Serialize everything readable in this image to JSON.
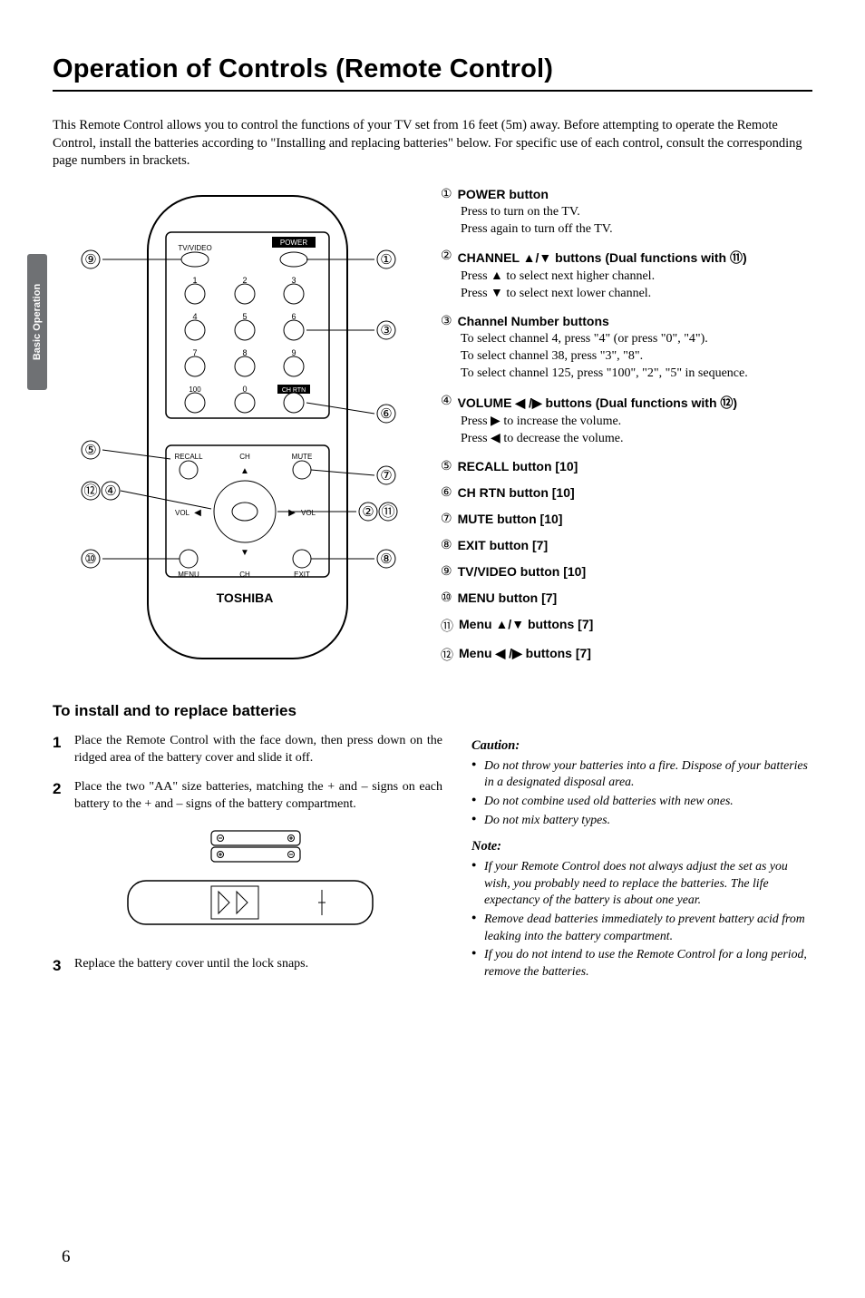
{
  "sidetab": "Basic Operation",
  "title": "Operation of Controls (Remote Control)",
  "intro": "This Remote Control allows you to control the functions of your TV set from 16 feet (5m) away. Before attempting to operate the Remote Control, install the batteries according to \"Installing and replacing batteries\" below. For specific use of each control, consult the corresponding page numbers in brackets.",
  "remote": {
    "labels": {
      "tvvideo": "TV/VIDEO",
      "power": "POWER",
      "recall": "RECALL",
      "ch_top": "CH",
      "mute": "MUTE",
      "vol_l": "VOL",
      "vol_r": "VOL",
      "menu": "MENU",
      "ch_bot": "CH",
      "exit": "EXIT",
      "chrtn": "CH RTN",
      "brand": "TOSHIBA",
      "k1": "1",
      "k2": "2",
      "k3": "3",
      "k4": "4",
      "k5": "5",
      "k6": "6",
      "k7": "7",
      "k8": "8",
      "k9": "9",
      "k100": "100",
      "k0": "0"
    },
    "callouts": {
      "c1": "①",
      "c2": "②",
      "c3": "③",
      "c4": "④",
      "c5": "⑤",
      "c6": "⑥",
      "c7": "⑦",
      "c8": "⑧",
      "c9": "⑨",
      "c10": "⑩",
      "c11": "⑪",
      "c12": "⑫"
    }
  },
  "controls": {
    "c1": {
      "num": "①",
      "title": "POWER  button",
      "body_a": "Press to turn on the TV.",
      "body_b": "Press again to turn off the TV."
    },
    "c2": {
      "num": "②",
      "title_pre": "CHANNEL ",
      "title_mid": "▲/▼",
      "title_post": " buttons (Dual functions with  ⑪)",
      "body_a": "Press ▲ to select next higher channel.",
      "body_b": "Press ▼ to select next lower channel."
    },
    "c3": {
      "num": "③",
      "title": "Channel Number buttons",
      "body_a": "To select channel 4, press \"4\" (or press \"0\", \"4\").",
      "body_b": "To select channel 38, press \"3\", \"8\".",
      "body_c": "To select channel 125, press \"100\", \"2\", \"5\" in sequence."
    },
    "c4": {
      "num": "④",
      "title_pre": "VOLUME ",
      "title_mid": "◀ /▶",
      "title_post": " buttons (Dual functions with  ⑫)",
      "body_a": "Press ▶ to increase the volume.",
      "body_b": "Press ◀ to decrease the volume."
    },
    "c5": {
      "num": "⑤",
      "title": "RECALL button [10]"
    },
    "c6": {
      "num": "⑥",
      "title": "CH RTN button [10]"
    },
    "c7": {
      "num": "⑦",
      "title": "MUTE button [10]"
    },
    "c8": {
      "num": "⑧",
      "title": "EXIT button [7]"
    },
    "c9": {
      "num": "⑨",
      "title": "TV/VIDEO button [10]"
    },
    "c10": {
      "num": "⑩",
      "title": "MENU button [7]"
    },
    "c11": {
      "num": "⑪",
      "title_pre": "Menu ",
      "title_mid": "▲/▼",
      "title_post": " buttons [7]"
    },
    "c12": {
      "num": "⑫",
      "title_pre": "Menu ",
      "title_mid": "◀ /▶",
      "title_post": " buttons [7]"
    }
  },
  "install": {
    "heading": "To install and to replace batteries",
    "s1n": "1",
    "s1": "Place the Remote Control with the face down, then press down on the ridged area of the battery cover and slide it off.",
    "s2n": "2",
    "s2": "Place the two \"AA\" size batteries, matching the + and – signs on each battery to the + and – signs of the battery compartment.",
    "s3n": "3",
    "s3": "Replace the battery cover until the lock snaps."
  },
  "caution": {
    "heading": "Caution:",
    "b1": "Do not throw your batteries into a fire. Dispose of your batteries in a designated disposal area.",
    "b2": "Do not combine used old batteries with new ones.",
    "b3": "Do not mix battery types."
  },
  "note": {
    "heading": "Note:",
    "b1": "If your Remote Control does not always adjust the set as you wish, you probably need to replace the batteries. The life expectancy of the battery is about one year.",
    "b2": "Remove dead batteries immediately to prevent battery acid from leaking into the battery compartment.",
    "b3": "If you do not intend to use the Remote Control for a long period, remove the batteries."
  },
  "pagenum": "6"
}
